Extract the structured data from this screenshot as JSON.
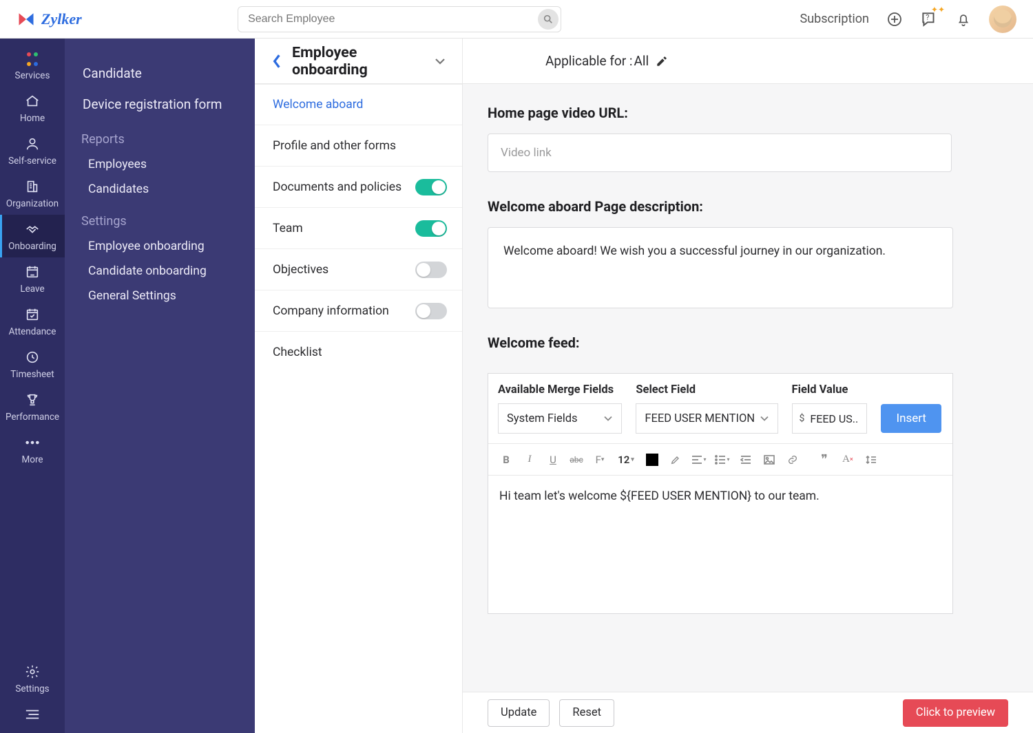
{
  "brand": "Zylker",
  "search": {
    "placeholder": "Search Employee"
  },
  "topbar": {
    "subscription": "Subscription"
  },
  "rail": [
    {
      "key": "services",
      "label": "Services"
    },
    {
      "key": "home",
      "label": "Home"
    },
    {
      "key": "self-service",
      "label": "Self-service"
    },
    {
      "key": "organization",
      "label": "Organization"
    },
    {
      "key": "onboarding",
      "label": "Onboarding"
    },
    {
      "key": "leave",
      "label": "Leave"
    },
    {
      "key": "attendance",
      "label": "Attendance"
    },
    {
      "key": "timesheet",
      "label": "Timesheet"
    },
    {
      "key": "performance",
      "label": "Performance"
    },
    {
      "key": "more",
      "label": "More"
    },
    {
      "key": "settings",
      "label": "Settings"
    }
  ],
  "secnav": {
    "top": [
      "Candidate",
      "Device registration form"
    ],
    "reports_heading": "Reports",
    "reports": [
      "Employees",
      "Candidates"
    ],
    "settings_heading": "Settings",
    "settings": [
      "Employee onboarding",
      "Candidate onboarding",
      "General Settings"
    ]
  },
  "page": {
    "title": "Employee onboarding",
    "applicable_label": "Applicable for :",
    "applicable_value": "All"
  },
  "tabs": [
    {
      "label": "Welcome aboard",
      "toggle": null,
      "active": true
    },
    {
      "label": "Profile and other forms",
      "toggle": null,
      "active": false
    },
    {
      "label": "Documents and policies",
      "toggle": true,
      "active": false
    },
    {
      "label": "Team",
      "toggle": true,
      "active": false
    },
    {
      "label": "Objectives",
      "toggle": false,
      "active": false
    },
    {
      "label": "Company information",
      "toggle": false,
      "active": false
    },
    {
      "label": "Checklist",
      "toggle": null,
      "active": false
    }
  ],
  "form": {
    "video_url_heading": "Home page video URL:",
    "video_url_placeholder": "Video link",
    "description_heading": "Welcome aboard Page description:",
    "description_value": "Welcome aboard! We wish you a successful journey in our organization.",
    "feed_heading": "Welcome feed:",
    "merge": {
      "heading_fields": "Available Merge Fields",
      "heading_select": "Select Field",
      "heading_value": "Field Value",
      "fields_value": "System Fields",
      "select_value": "FEED USER MENTION",
      "field_value": "FEED US..",
      "insert_label": "Insert"
    },
    "rte_font_size": "12",
    "rte_body": "Hi team let's welcome ${FEED USER MENTION} to our team."
  },
  "footer": {
    "update": "Update",
    "reset": "Reset",
    "preview": "Click to preview"
  }
}
